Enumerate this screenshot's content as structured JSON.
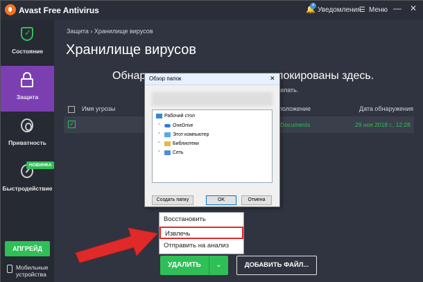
{
  "app": {
    "title": "Avast Free Antivirus",
    "notifications_count": "4",
    "notifications_label": "Уведомления",
    "menu_label": "Меню",
    "minimize_glyph": "—",
    "close_glyph": "✕"
  },
  "sidebar": {
    "items": [
      {
        "label": "Состояние",
        "icon": "shield-check-icon"
      },
      {
        "label": "Защита",
        "icon": "lock-icon",
        "active": true
      },
      {
        "label": "Приватность",
        "icon": "fingerprint-icon"
      },
      {
        "label": "Быстродействие",
        "icon": "gauge-icon",
        "badge": "НОВИНКА"
      }
    ],
    "upgrade_label": "АПГРЕЙД",
    "mobile_label_1": "Мобильные",
    "mobile_label_2": "устройства"
  },
  "main": {
    "breadcrumb": "Защита › Хранилище вирусов",
    "title": "Хранилище вирусов",
    "heading_left": "Обнар",
    "heading_right": "локированы здесь.",
    "subtext": "делать.",
    "columns": {
      "name": "Имя угрозы",
      "location": "положение",
      "date": "Дата обнаружения"
    },
    "row": {
      "checked": "✓",
      "location": "/Documents",
      "date": "29 ноя 2018 г., 12:28"
    },
    "delete_label": "УДАЛИТЬ",
    "delete_arrow": "⌄",
    "add_file_label": "ДОБАВИТЬ ФАЙЛ..."
  },
  "dropdown": {
    "items": [
      "Восстановить",
      "Извлечь",
      "Отправить на анализ"
    ],
    "highlighted_index": 1
  },
  "dialog": {
    "title": "Обзор папок",
    "close_glyph": "✕",
    "tree": [
      {
        "label": "Рабочий стол",
        "icon": "desktop-icon",
        "level": 0
      },
      {
        "label": "OneDrive",
        "icon": "cloud-icon",
        "level": 1
      },
      {
        "label": "Этот компьютер",
        "icon": "computer-icon",
        "level": 1
      },
      {
        "label": "Библиотеки",
        "icon": "library-icon",
        "level": 1
      },
      {
        "label": "Сеть",
        "icon": "network-icon",
        "level": 1
      }
    ],
    "buttons": {
      "create": "Создать папку",
      "ok": "OK",
      "cancel": "Отмена"
    }
  },
  "colors": {
    "accent_green": "#2fbf57",
    "active_purple": "#7b3fb2",
    "highlight_red": "#e02a2a"
  }
}
